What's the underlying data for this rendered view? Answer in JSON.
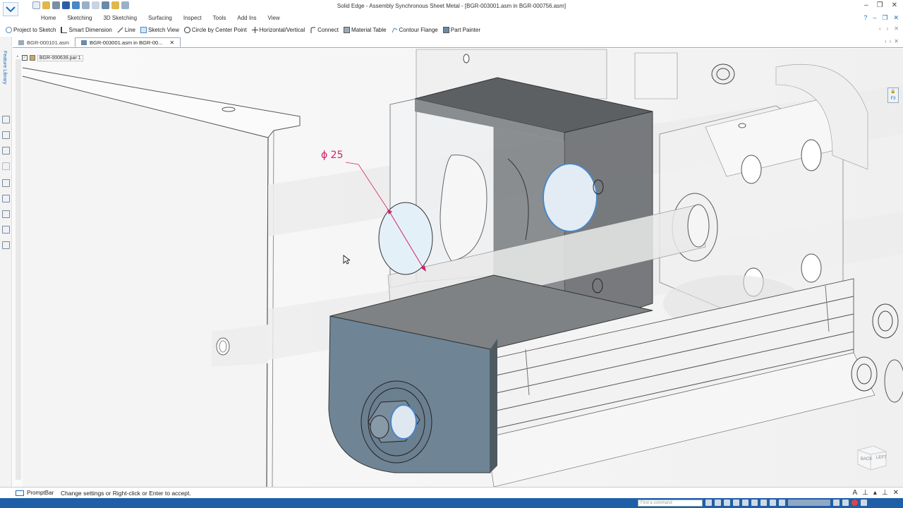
{
  "window": {
    "title": "Solid Edge - Assembly Synchronous Sheet Metal - [BGR-003001.asm in BGR-000756.asm]"
  },
  "ribbon": {
    "tabs": [
      "Home",
      "Sketching",
      "3D Sketching",
      "Surfacing",
      "Inspect",
      "Tools",
      "Add Ins",
      "View"
    ]
  },
  "commandbar": {
    "items": [
      "Project to Sketch",
      "Smart Dimension",
      "Line",
      "Sketch View",
      "Circle by Center Point",
      "Horizontal/Vertical",
      "Connect",
      "Material Table",
      "Contour Flange",
      "Part Painter"
    ]
  },
  "doctabs": [
    {
      "label": "BGR-000101.asm"
    },
    {
      "label": "BGR-003001.asm in BGR-00..."
    }
  ],
  "leftpanel": {
    "vertical_label": "Feature Library",
    "tree_item": "BGR-000639.par:1"
  },
  "viewport": {
    "dimension_text": "ϕ 25",
    "accent_dimension_color": "#d0226a",
    "viewcube_labels": [
      "BACK",
      "LEFT"
    ],
    "right_indicator": "F3"
  },
  "status": {
    "promptbar_label": "PromptBar",
    "prompt_text": "Change settings or Right-click or Enter to accept.",
    "find_placeholder": "Find a command"
  },
  "colors": {
    "accent": "#1f5fa8",
    "selected_face": "#6a8aa0"
  }
}
